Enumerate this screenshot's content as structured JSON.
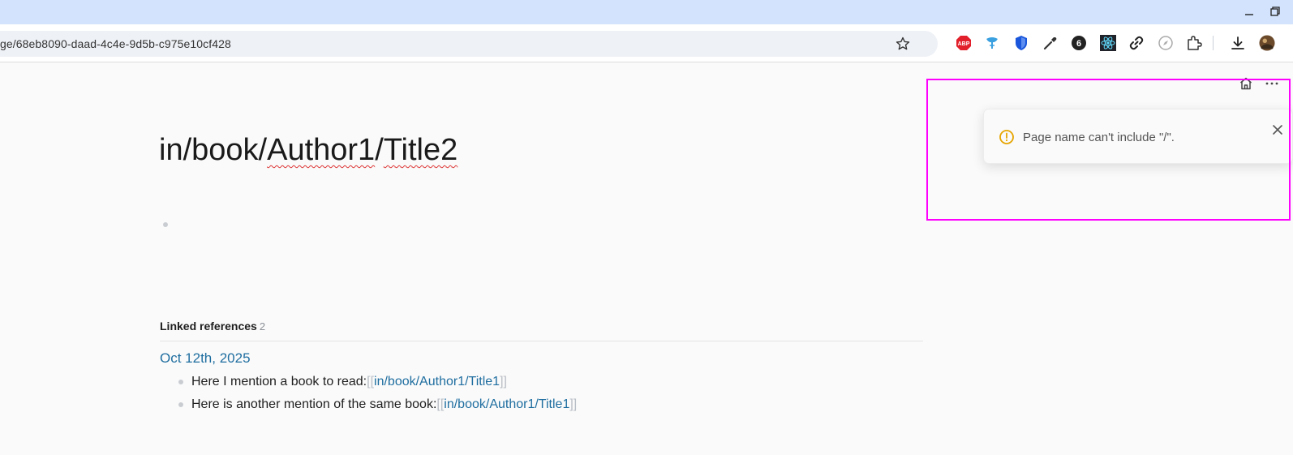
{
  "browser": {
    "url": "ge/68eb8090-daad-4c4e-9d5b-c975e10cf428",
    "extensions": [
      "adblock-plus-icon",
      "translate-icon",
      "shield-icon",
      "eyedropper-icon",
      "six-icon",
      "react-devtools-icon",
      "link-icon",
      "compass-icon",
      "puzzle-icon",
      "download-icon",
      "avatar-icon"
    ]
  },
  "page": {
    "title_part1": "in/book/",
    "title_part2": "Author1",
    "title_part3": "/",
    "title_part4": "Title2"
  },
  "linked_refs": {
    "label": "Linked references",
    "count": "2",
    "date": "Oct 12th, 2025",
    "items": [
      {
        "text": "Here I mention a book to read: ",
        "open": "[[",
        "link": "in/book/Author1/Title1",
        "close": "]]"
      },
      {
        "text": "Here is another mention of the same book: ",
        "open": "[[",
        "link": "in/book/Author1/Title1",
        "close": "]]"
      }
    ]
  },
  "toast": {
    "message": "Page name can't include \"/\"."
  },
  "colors": {
    "accent_link": "#1f6ea0",
    "warning": "#e6a500",
    "highlight": "#ff00ff"
  }
}
